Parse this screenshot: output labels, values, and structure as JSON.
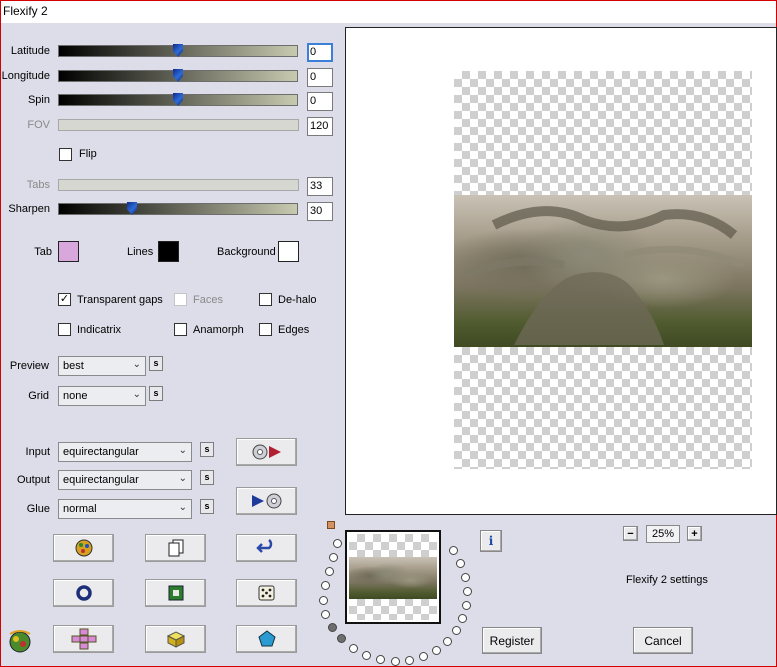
{
  "window": {
    "title": "Flexify 2"
  },
  "sliders": {
    "latitude": {
      "label": "Latitude",
      "value": "0"
    },
    "longitude": {
      "label": "Longitude",
      "value": "0"
    },
    "spin": {
      "label": "Spin",
      "value": "0"
    },
    "fov": {
      "label": "FOV",
      "value": "120"
    },
    "tabs": {
      "label": "Tabs",
      "value": "33"
    },
    "sharpen": {
      "label": "Sharpen",
      "value": "30"
    }
  },
  "flip": {
    "label": "Flip"
  },
  "colors": {
    "tab": {
      "label": "Tab",
      "color": "#d8a8dc"
    },
    "lines": {
      "label": "Lines",
      "color": "#000000"
    },
    "background": {
      "label": "Background",
      "color": "#ffffff"
    }
  },
  "options": {
    "transparent_gaps": {
      "label": "Transparent gaps",
      "checked": "✓"
    },
    "faces": {
      "label": "Faces"
    },
    "de_halo": {
      "label": "De-halo"
    },
    "indicatrix": {
      "label": "Indicatrix"
    },
    "anamorph": {
      "label": "Anamorph"
    },
    "edges": {
      "label": "Edges"
    }
  },
  "preview": {
    "label": "Preview",
    "value": "best",
    "s": "s"
  },
  "grid": {
    "label": "Grid",
    "value": "none",
    "s": "s"
  },
  "input": {
    "label": "Input",
    "value": "equirectangular",
    "s": "s"
  },
  "output": {
    "label": "Output",
    "value": "equirectangular",
    "s": "s"
  },
  "glue": {
    "label": "Glue",
    "value": "normal",
    "s": "s"
  },
  "zoom": {
    "value": "25%",
    "minus": "−",
    "plus": "+"
  },
  "info": {
    "icon": "i"
  },
  "settings_label": "Flexify 2 settings",
  "buttons": {
    "register": "Register",
    "cancel": "Cancel"
  },
  "icons": {
    "palette": "palette-icon",
    "pages": "pages-icon",
    "undo": "undo-arrow-icon",
    "ring": "ring-icon",
    "square": "frame-square-icon",
    "dice": "dice-icon",
    "cross": "cross-layout-icon",
    "cube": "cube-icon",
    "pentagon": "pentagon-icon",
    "logo": "flexify-logo-icon"
  }
}
